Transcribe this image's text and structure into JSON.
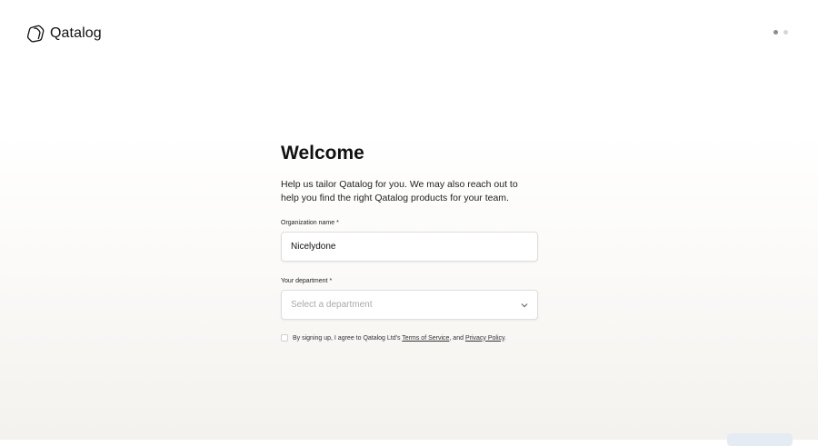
{
  "header": {
    "brand_name": "Qatalog",
    "logo_icon": "qatalog-logo-icon",
    "steps": [
      {
        "state": "active"
      },
      {
        "state": "inactive"
      }
    ]
  },
  "form": {
    "title": "Welcome",
    "intro": "Help us tailor Qatalog for you. We may also reach out to help you find the right Qatalog products for your team.",
    "organization": {
      "label": "Organization name *",
      "value": "Nicelydone"
    },
    "department": {
      "label": "Your department *",
      "placeholder": "Select a department",
      "icon": "chevron-down-icon"
    },
    "agreement": {
      "prefix": "By signing up, I agree to Qatalog Ltd's ",
      "terms_link": "Terms of Service",
      "middle": ", and ",
      "privacy_link": "Privacy Policy",
      "suffix": ".",
      "checked": false
    }
  },
  "colors": {
    "accent_button": "#e4ebf3",
    "dot_active": "#8c8c8c",
    "dot_inactive": "#d6d6d6",
    "placeholder": "#a9a9a9"
  }
}
